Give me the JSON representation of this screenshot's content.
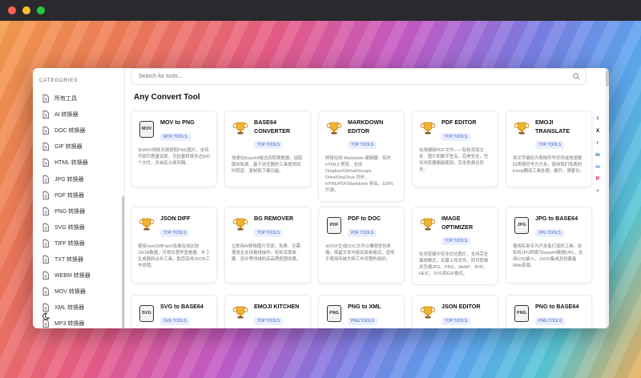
{
  "window_controls": {
    "close_color": "#fe5f57",
    "minimize_color": "#febc2e",
    "maximize_color": "#28c840"
  },
  "sidebar": {
    "title": "CATEGORIES",
    "items": [
      {
        "label": "所有工具",
        "icon": "document-icon"
      },
      {
        "label": "AI 转换器",
        "icon": "document-icon"
      },
      {
        "label": "DOC 转换器",
        "icon": "document-icon"
      },
      {
        "label": "GIF 转换器",
        "icon": "document-icon"
      },
      {
        "label": "HTML 转换器",
        "icon": "document-icon"
      },
      {
        "label": "JPG 转换器",
        "icon": "document-icon"
      },
      {
        "label": "PDF 转换器",
        "icon": "document-icon"
      },
      {
        "label": "PNG 转换器",
        "icon": "document-icon"
      },
      {
        "label": "SVG 转换器",
        "icon": "document-icon"
      },
      {
        "label": "TIFF 转换器",
        "icon": "document-icon"
      },
      {
        "label": "TXT 转换器",
        "icon": "document-icon"
      },
      {
        "label": "WEBM 转换器",
        "icon": "document-icon"
      },
      {
        "label": "MOV 转换器",
        "icon": "document-icon"
      },
      {
        "label": "XML 转换器",
        "icon": "document-icon"
      },
      {
        "label": "MP3 转换器",
        "icon": "document-icon"
      }
    ]
  },
  "search": {
    "placeholder": "Search for tools..."
  },
  "page_title": "Any Convert Tool",
  "cards": [
    {
      "title": "MOV to PNG",
      "badge": "MOV TOOLS",
      "icon": "MOV",
      "desc": "从MOV视频无损提取PNG图片，支持可调节质量设置，可批量转换多达500个文件，并自定义帧间隔。"
    },
    {
      "title": "BASE64 CONVERTER",
      "badge": "TOP TOOLS",
      "icon": "trophy",
      "desc": "快速在Base64格式间转换数据。追踪面向免费、基于浏览器的工具提供即时转定、复制和下载功能。"
    },
    {
      "title": "MARKDOWN EDITOR",
      "badge": "TOP TOOLS",
      "icon": "trophy",
      "desc": "终极在线 Markdown 编辑器：实时 HTML5 预览、支持 Dropbox/GitHub/Google Drive/OneDrive 同步，HTML/PDF/Markdown 导出。100% 开源。"
    },
    {
      "title": "PDF EDITOR",
      "badge": "TOP TOOLS",
      "icon": "trophy",
      "desc": "在线编辑PDF文件——轻松添加文本、图片和数字签名。完美安全，任何浏览器都能使用，完全免费且安全。"
    },
    {
      "title": "EMOJI TRANSLATE",
      "badge": "TOP TOOLS",
      "icon": "trophy",
      "desc": "将文字编码为表情符号序列或快速解码表情符号为文本。使用我们免费的Emoji翻译工具处理。翻开，博客化。"
    },
    {
      "title": "JSON DIFF",
      "badge": "TOP TOOLS",
      "icon": "trophy",
      "desc": "使用JsonDiffPatch免费在线比较JSON数据，可视化差异查看器，补丁生成器和合并工具，助您高效JSON工作流程。"
    },
    {
      "title": "BG REMOVER",
      "badge": "TOP TOOLS",
      "icon": "trophy",
      "desc": "立即用AI移除图片背景。免费、无需使用且支持离线操作，轻松实现收藏、设计等领域的高品质抠图效果。"
    },
    {
      "title": "PDF to DOC",
      "badge": "PDF TOOLS",
      "icon": "PDF",
      "desc": "从PDF生成DOC文件以兼容性包条格。保留文本内容及简单格式，适用于使用传统文档工作流程的组织。"
    },
    {
      "title": "IMAGE OPTIMIZER",
      "badge": "TOP TOOLS",
      "icon": "trophy",
      "desc": "在浏览器中安全优化图片，支持完全离线模式，无需上传文件，即可转换并压缩JPG、PNG、WebP、AVIF、HEIC、SVG和GIF格式。"
    },
    {
      "title": "JPG to BASE64",
      "badge": "JPG TOOLS",
      "icon": "JPG",
      "desc": "使用实用专为开发者打造的工具，轻松将JPG转换为base64数据URL，支持CSS嵌入、JSON集成及较量备Web资源。"
    },
    {
      "title": "SVG to BASE64",
      "badge": "SVG TOOLS",
      "icon": "SVG",
      "desc": "将SVG图形编码为Base64数据URI，即时"
    },
    {
      "title": "EMOJI KITCHEN",
      "badge": "TOP TOOLS",
      "icon": "trophy",
      "desc": "在「Emoji厨房」中以组合任意两种表情"
    },
    {
      "title": "PNG to XML",
      "badge": "PNG TOOLS",
      "icon": "PNG",
      "desc": "将PNG图像转为XML，保留结构和系统"
    },
    {
      "title": "JSON EDITOR",
      "badge": "TOP TOOLS",
      "icon": "trophy",
      "desc": "在线比较和编辑JSON数据，树形"
    },
    {
      "title": "PNG to BASE64",
      "badge": "PNG TOOLS",
      "icon": "PNG",
      "desc": "将PNG编码为Base64以便直接嵌入代"
    }
  ],
  "share": [
    {
      "glyph": "f",
      "name": "facebook-icon",
      "color": "#1877f2"
    },
    {
      "glyph": "X",
      "name": "x-icon",
      "color": "#111111"
    },
    {
      "glyph": "r",
      "name": "reddit-icon",
      "color": "#ff4500"
    },
    {
      "glyph": "in",
      "name": "linkedin-icon",
      "color": "#0a66c2"
    },
    {
      "glyph": "m",
      "name": "messenger-icon",
      "color": "#448aff"
    },
    {
      "glyph": "P",
      "name": "pinterest-icon",
      "color": "#e60023"
    },
    {
      "glyph": "<",
      "name": "share-icon",
      "color": "#44b04c"
    }
  ]
}
